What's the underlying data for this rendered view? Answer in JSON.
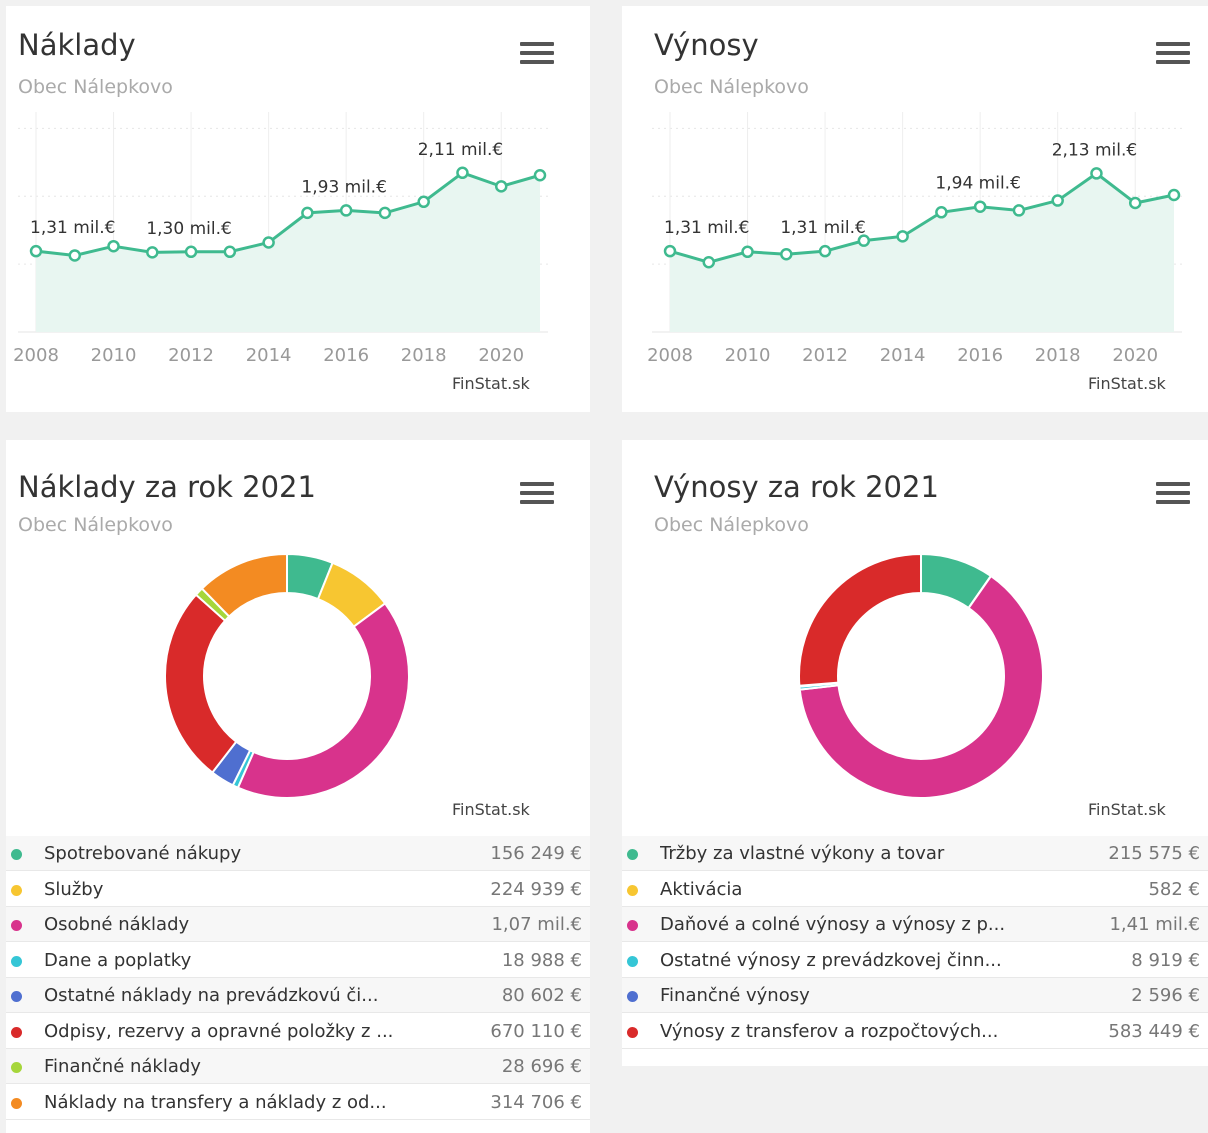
{
  "colors": {
    "line": "#3fba8f",
    "area": "#e8f6f1",
    "grid": "#e6e6e6",
    "green": "#3fba8f",
    "yellow": "#f7c631",
    "magenta": "#d8338c",
    "cyan": "#35c6d6",
    "blue": "#4f6fd0",
    "red": "#d92a2a",
    "lime": "#a6d63b",
    "orange": "#f38b22"
  },
  "panels": {
    "naklady_line": {
      "title": "Náklady",
      "subtitle": "Obec Nálepkovo",
      "credit": "FinStat.sk",
      "menu_icon": "hamburger-menu-icon"
    },
    "vynosy_line": {
      "title": "Výnosy",
      "subtitle": "Obec Nálepkovo",
      "credit": "FinStat.sk",
      "menu_icon": "hamburger-menu-icon"
    },
    "naklady_donut": {
      "title": "Náklady za rok 2021",
      "subtitle": "Obec Nálepkovo",
      "credit": "FinStat.sk",
      "menu_icon": "hamburger-menu-icon"
    },
    "vynosy_donut": {
      "title": "Výnosy za rok 2021",
      "subtitle": "Obec Nálepkovo",
      "credit": "FinStat.sk",
      "menu_icon": "hamburger-menu-icon"
    }
  },
  "chart_data": [
    {
      "type": "area",
      "title": "Náklady",
      "subtitle": "Obec Nálepkovo",
      "x": [
        2008,
        2009,
        2010,
        2011,
        2012,
        2013,
        2014,
        2015,
        2016,
        2017,
        2018,
        2019,
        2020,
        2021
      ],
      "values": [
        1.31,
        1.24,
        1.39,
        1.29,
        1.3,
        1.3,
        1.45,
        1.93,
        1.97,
        1.93,
        2.11,
        2.58,
        2.36,
        2.54
      ],
      "data_labels": [
        {
          "x": 2008,
          "text": "1,31 mil.€"
        },
        {
          "x": 2012,
          "text": "1,30 mil.€"
        },
        {
          "x": 2016,
          "text": "1,93 mil.€"
        },
        {
          "x": 2019,
          "text": "2,11 mil.€"
        }
      ],
      "x_ticks": [
        "2008",
        "2010",
        "2012",
        "2014",
        "2016",
        "2018",
        "2020"
      ],
      "xlim": [
        2008,
        2021
      ],
      "ylim": [
        0,
        3.5
      ],
      "grid": true,
      "legend": "none"
    },
    {
      "type": "area",
      "title": "Výnosy",
      "subtitle": "Obec Nálepkovo",
      "x": [
        2008,
        2009,
        2010,
        2011,
        2012,
        2013,
        2014,
        2015,
        2016,
        2017,
        2018,
        2019,
        2020,
        2021
      ],
      "values": [
        1.31,
        1.13,
        1.3,
        1.26,
        1.31,
        1.48,
        1.55,
        1.94,
        2.03,
        1.97,
        2.13,
        2.57,
        2.09,
        2.22
      ],
      "data_labels": [
        {
          "x": 2008,
          "text": "1,31 mil.€"
        },
        {
          "x": 2012,
          "text": "1,31 mil.€"
        },
        {
          "x": 2016,
          "text": "1,94 mil.€"
        },
        {
          "x": 2019,
          "text": "2,13 mil.€"
        }
      ],
      "x_ticks": [
        "2008",
        "2010",
        "2012",
        "2014",
        "2016",
        "2018",
        "2020"
      ],
      "xlim": [
        2008,
        2021
      ],
      "ylim": [
        0,
        3.5
      ],
      "grid": true,
      "legend": "none"
    },
    {
      "type": "pie",
      "variant": "donut",
      "title": "Náklady za rok 2021",
      "subtitle": "Obec Nálepkovo",
      "legend": "bottom",
      "slices": [
        {
          "name": "Spotrebované nákupy",
          "label": "Spotrebované nákupy",
          "value": 156249,
          "value_text": "156 249 €",
          "color": "#3fba8f"
        },
        {
          "name": "Služby",
          "label": "Služby",
          "value": 224939,
          "value_text": "224 939 €",
          "color": "#f7c631"
        },
        {
          "name": "Osobné náklady",
          "label": "Osobné náklady",
          "value": 1070000,
          "value_text": "1,07 mil.€",
          "color": "#d8338c"
        },
        {
          "name": "Dane a poplatky",
          "label": "Dane a poplatky",
          "value": 18988,
          "value_text": "18 988 €",
          "color": "#35c6d6"
        },
        {
          "name": "Ostatné náklady na prevádzkovú činnosť",
          "label": "Ostatné náklady na prevádzkovú či...",
          "value": 80602,
          "value_text": "80 602 €",
          "color": "#4f6fd0"
        },
        {
          "name": "Odpisy, rezervy a opravné položky z ...",
          "label": "Odpisy, rezervy a opravné položky z ...",
          "value": 670110,
          "value_text": "670 110 €",
          "color": "#d92a2a"
        },
        {
          "name": "Finančné náklady",
          "label": "Finančné náklady",
          "value": 28696,
          "value_text": "28 696 €",
          "color": "#a6d63b"
        },
        {
          "name": "Náklady na transfery a náklady z od...",
          "label": "Náklady na transfery a náklady z od...",
          "value": 314706,
          "value_text": "314 706 €",
          "color": "#f38b22"
        }
      ]
    },
    {
      "type": "pie",
      "variant": "donut",
      "title": "Výnosy za rok 2021",
      "subtitle": "Obec Nálepkovo",
      "legend": "bottom",
      "slices": [
        {
          "name": "Tržby za vlastné výkony a tovar",
          "label": "Tržby za vlastné výkony a tovar",
          "value": 215575,
          "value_text": "215 575 €",
          "color": "#3fba8f"
        },
        {
          "name": "Aktivácia",
          "label": "Aktivácia",
          "value": 582,
          "value_text": "582 €",
          "color": "#f7c631"
        },
        {
          "name": "Daňové a colné výnosy a výnosy z p...",
          "label": "Daňové a colné výnosy a výnosy z p...",
          "value": 1410000,
          "value_text": "1,41 mil.€",
          "color": "#d8338c"
        },
        {
          "name": "Ostatné výnosy z prevádzkovej činn...",
          "label": "Ostatné výnosy z prevádzkovej činn...",
          "value": 8919,
          "value_text": "8 919 €",
          "color": "#35c6d6"
        },
        {
          "name": "Finančné výnosy",
          "label": "Finančné výnosy",
          "value": 2596,
          "value_text": "2 596 €",
          "color": "#4f6fd0"
        },
        {
          "name": "Výnosy z transferov a rozpočtových...",
          "label": "Výnosy z transferov a rozpočtových...",
          "value": 583449,
          "value_text": "583 449 €",
          "color": "#d92a2a"
        }
      ]
    }
  ]
}
